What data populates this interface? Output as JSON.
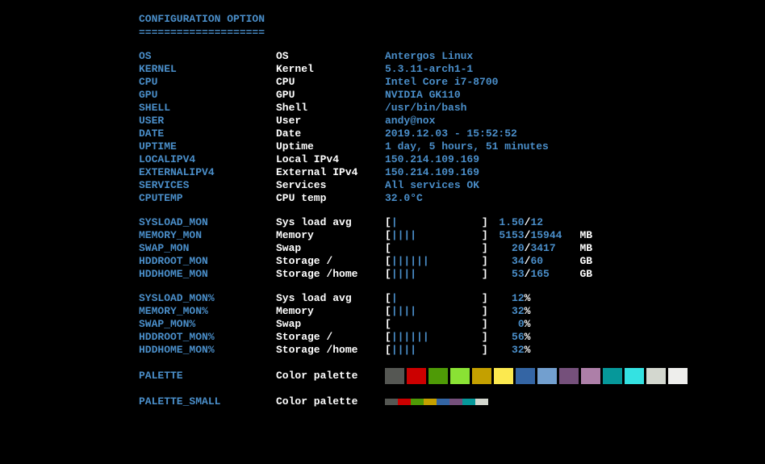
{
  "header": {
    "title": "CONFIGURATION OPTION",
    "divider": "===================="
  },
  "info": [
    {
      "key": "OS",
      "label": "OS",
      "value": "Antergos Linux"
    },
    {
      "key": "KERNEL",
      "label": "Kernel",
      "value": "5.3.11-arch1-1"
    },
    {
      "key": "CPU",
      "label": "CPU",
      "value": "Intel Core i7-8700"
    },
    {
      "key": "GPU",
      "label": "GPU",
      "value": "NVIDIA GK110"
    },
    {
      "key": "SHELL",
      "label": "Shell",
      "value": "/usr/bin/bash"
    },
    {
      "key": "USER",
      "label": "User",
      "value": "andy@nox"
    },
    {
      "key": "DATE",
      "label": "Date",
      "value": "2019.12.03 - 15:52:52"
    },
    {
      "key": "UPTIME",
      "label": "Uptime",
      "value": "1 day, 5 hours, 51 minutes"
    },
    {
      "key": "LOCALIPV4",
      "label": "Local IPv4",
      "value": "150.214.109.169"
    },
    {
      "key": "EXTERNALIPV4",
      "label": "External IPv4",
      "value": "150.214.109.169"
    },
    {
      "key": "SERVICES",
      "label": "Services",
      "value": "All services OK"
    },
    {
      "key": "CPUTEMP",
      "label": "CPU temp",
      "value": "32.0°C"
    }
  ],
  "monitors": [
    {
      "key": "SYSLOAD_MON",
      "label": "Sys load avg",
      "bar": "|",
      "used": "1.50",
      "total": "12",
      "unit": ""
    },
    {
      "key": "MEMORY_MON",
      "label": "Memory",
      "bar": "||||",
      "used": "5153",
      "total": "15944",
      "unit": "MB"
    },
    {
      "key": "SWAP_MON",
      "label": "Swap",
      "bar": "",
      "used": "20",
      "total": "3417",
      "unit": "MB"
    },
    {
      "key": "HDDROOT_MON",
      "label": "Storage /",
      "bar": "||||||",
      "used": "34",
      "total": "60",
      "unit": "GB"
    },
    {
      "key": "HDDHOME_MON",
      "label": "Storage /home",
      "bar": "||||",
      "used": "53",
      "total": "165",
      "unit": "GB"
    }
  ],
  "monitors_pct": [
    {
      "key": "SYSLOAD_MON%",
      "label": "Sys load avg",
      "bar": "|",
      "pct": "12"
    },
    {
      "key": "MEMORY_MON%",
      "label": "Memory",
      "bar": "||||",
      "pct": "32"
    },
    {
      "key": "SWAP_MON%",
      "label": "Swap",
      "bar": "",
      "pct": "0"
    },
    {
      "key": "HDDROOT_MON%",
      "label": "Storage /",
      "bar": "||||||",
      "pct": "56"
    },
    {
      "key": "HDDHOME_MON%",
      "label": "Storage /home",
      "bar": "||||",
      "pct": "32"
    }
  ],
  "pct_symbol": "%",
  "slash": "/",
  "palette": {
    "key": "PALETTE",
    "label": "Color palette",
    "colors": [
      "#555753",
      "#cc0000",
      "#4e9a06",
      "#8ae234",
      "#c4a000",
      "#fce94f",
      "#3465a4",
      "#729fcf",
      "#75507b",
      "#ad7fa8",
      "#06989a",
      "#34e2e2",
      "#d3d7cf",
      "#eeeeec"
    ]
  },
  "palette_small": {
    "key": "PALETTE_SMALL",
    "label": "Color palette",
    "colors": [
      "#555753",
      "#cc0000",
      "#4e9a06",
      "#c4a000",
      "#3465a4",
      "#75507b",
      "#06989a",
      "#d3d7cf"
    ]
  }
}
